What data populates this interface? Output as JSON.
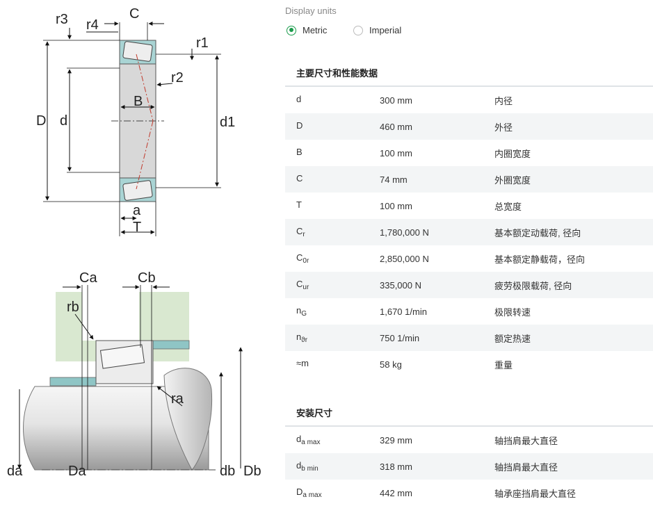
{
  "diagram": {
    "top_labels": {
      "r3": "r3",
      "r4": "r4",
      "C": "C",
      "r1": "r1",
      "r2": "r2",
      "D": "D",
      "d": "d",
      "B": "B",
      "d1": "d1",
      "a": "a",
      "T": "T"
    },
    "bottom_labels": {
      "Ca": "Ca",
      "Cb": "Cb",
      "rb": "rb",
      "ra": "ra",
      "da": "da",
      "Da": "Da",
      "db": "db",
      "Db": "Db"
    }
  },
  "display_units": {
    "label": "Display units",
    "options": [
      {
        "label": "Metric",
        "selected": true
      },
      {
        "label": "Imperial",
        "selected": false
      }
    ],
    "accent_color": "#1a9b4b"
  },
  "main_section": {
    "title": "主要尺寸和性能数据",
    "rows": [
      {
        "sym": "d",
        "sub": "",
        "value": "300 mm",
        "desc": "内径"
      },
      {
        "sym": "D",
        "sub": "",
        "value": "460 mm",
        "desc": "外径"
      },
      {
        "sym": "B",
        "sub": "",
        "value": "100 mm",
        "desc": "内圈宽度"
      },
      {
        "sym": "C",
        "sub": "",
        "value": "74 mm",
        "desc": "外圈宽度"
      },
      {
        "sym": "T",
        "sub": "",
        "value": "100 mm",
        "desc": "总宽度"
      },
      {
        "sym": "C",
        "sub": "r",
        "value": "1,780,000 N",
        "desc": "基本额定动载荷, 径向"
      },
      {
        "sym": "C",
        "sub": "0r",
        "value": "2,850,000 N",
        "desc": "基本额定静载荷，径向"
      },
      {
        "sym": "C",
        "sub": "ur",
        "value": "335,000 N",
        "desc": "疲劳极限载荷, 径向"
      },
      {
        "sym": "n",
        "sub": "G",
        "value": "1,670 1/min",
        "desc": "极限转速"
      },
      {
        "sym": "n",
        "sub": "ϑr",
        "value": "750 1/min",
        "desc": "额定热速"
      },
      {
        "sym": "≈m",
        "sub": "",
        "value": "58 kg",
        "desc": "重量"
      }
    ]
  },
  "mounting_section": {
    "title": "安装尺寸",
    "rows": [
      {
        "sym": "d",
        "sub": "a max",
        "value": "329 mm",
        "desc": "轴挡肩最大直径"
      },
      {
        "sym": "d",
        "sub": "b min",
        "value": "318 mm",
        "desc": "轴挡肩最大直径"
      },
      {
        "sym": "D",
        "sub": "a max",
        "value": "442 mm",
        "desc": "轴承座挡肩最大直径"
      }
    ]
  }
}
